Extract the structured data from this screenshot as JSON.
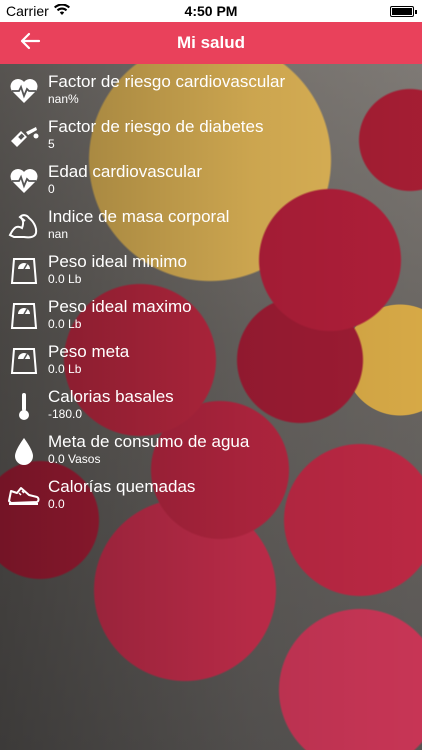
{
  "status": {
    "carrier": "Carrier",
    "time": "4:50 PM"
  },
  "nav": {
    "title": "Mi salud",
    "back_icon": "arrow-left-icon"
  },
  "items": [
    {
      "title": "Factor de riesgo cardiovascular",
      "value": "nan%",
      "icon": "heart-rate-icon"
    },
    {
      "title": "Factor de riesgo de diabetes",
      "value": "5",
      "icon": "glucose-meter-icon"
    },
    {
      "title": "Edad cardiovascular",
      "value": "0",
      "icon": "heart-rate-icon"
    },
    {
      "title": "Indice de masa corporal",
      "value": "nan",
      "icon": "flexed-arm-icon"
    },
    {
      "title": "Peso ideal minimo",
      "value": "0.0 Lb",
      "icon": "scale-icon"
    },
    {
      "title": "Peso ideal maximo",
      "value": "0.0 Lb",
      "icon": "scale-icon"
    },
    {
      "title": "Peso meta",
      "value": "0.0 Lb",
      "icon": "scale-icon"
    },
    {
      "title": "Calorias basales",
      "value": "-180.0",
      "icon": "thermometer-icon"
    },
    {
      "title": "Meta de consumo de agua",
      "value": "0.0 Vasos",
      "icon": "water-drop-icon"
    },
    {
      "title": "Calorías quemadas",
      "value": "0.0",
      "icon": "sneaker-icon"
    }
  ],
  "colors": {
    "nav_bar": "#e9415b",
    "text": "#ffffff"
  }
}
